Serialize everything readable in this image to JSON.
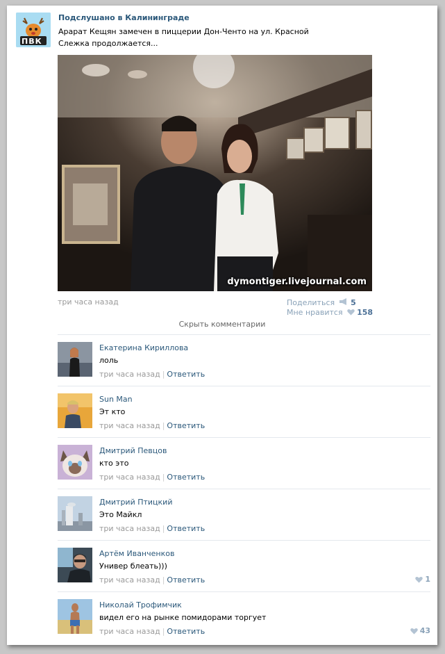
{
  "post": {
    "group_name": "Подслушано в Калининграде",
    "avatar_text": "ПВК",
    "text_line1": "Арарат Кещян замечен в пиццерии Дон-Ченто на ул. Красной",
    "text_line2": "Слежка продолжается...",
    "photo_watermark": "dymontiger.livejournal.com",
    "time": "три часа назад",
    "share_label": "Поделиться",
    "share_count": "5",
    "like_label": "Мне нравится",
    "like_count": "158"
  },
  "hide_comments_label": "Скрыть комментарии",
  "comments": [
    {
      "name": "Екатерина Кириллова",
      "text": "лоль",
      "time": "три часа назад",
      "reply": "Ответить",
      "likes": ""
    },
    {
      "name": "Sun Man",
      "text": "Эт кто",
      "time": "три часа назад",
      "reply": "Ответить",
      "likes": ""
    },
    {
      "name": "Дмитрий Певцов",
      "text": "кто это",
      "time": "три часа назад",
      "reply": "Ответить",
      "likes": ""
    },
    {
      "name": "Дмитрий Птицкий",
      "text": "Это Майкл",
      "time": "три часа назад",
      "reply": "Ответить",
      "likes": ""
    },
    {
      "name": "Артём Иванченков",
      "text": "Универ блеать)))",
      "time": "три часа назад",
      "reply": "Ответить",
      "likes": "1"
    },
    {
      "name": "Николай Трофимчик",
      "text": "видел его на рынке помидорами торгует",
      "time": "три часа назад",
      "reply": "Ответить",
      "likes": "43"
    }
  ],
  "colors": {
    "link": "#2b587a",
    "muted": "#999999",
    "like": "#8aa2b8"
  }
}
